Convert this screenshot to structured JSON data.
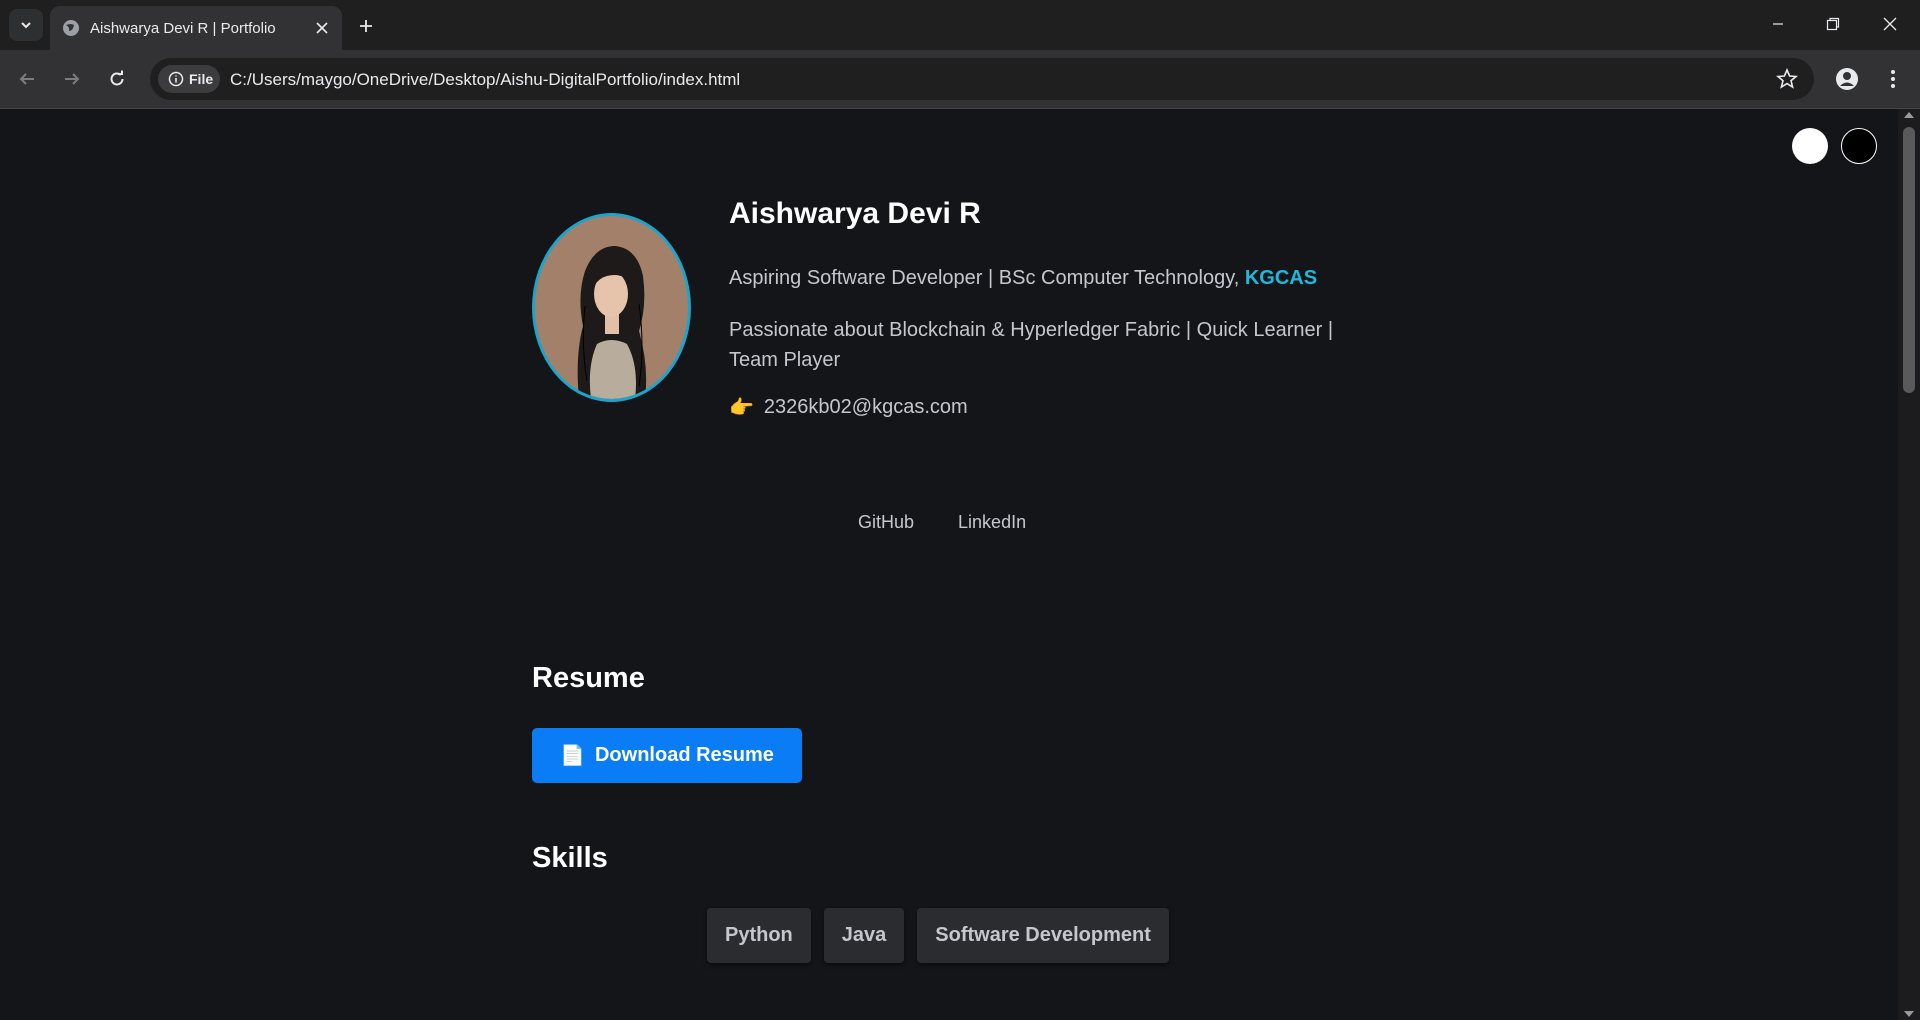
{
  "browser": {
    "tab_title": "Aishwarya Devi R | Portfolio",
    "url_chip": "File",
    "url": "C:/Users/maygo/OneDrive/Desktop/Aishu-DigitalPortfolio/index.html"
  },
  "profile": {
    "name": "Aishwarya Devi R",
    "subtitle_prefix": "Aspiring Software Developer | BSc Computer Technology, ",
    "subtitle_highlight": "KGCAS",
    "passion": "Passionate about Blockchain & Hyperledger Fabric | Quick Learner | Team Player",
    "email_icon": "👉",
    "email": "2326kb02@kgcas.com"
  },
  "links": [
    "GitHub",
    "LinkedIn"
  ],
  "resume": {
    "heading": "Resume",
    "button_icon": "📄",
    "button_label": "Download Resume"
  },
  "skills": {
    "heading": "Skills",
    "items": [
      "Python",
      "Java",
      "Software Development"
    ]
  },
  "colors": {
    "accent": "#1eb8dd",
    "button": "#0a7cf5",
    "background": "#141518"
  }
}
